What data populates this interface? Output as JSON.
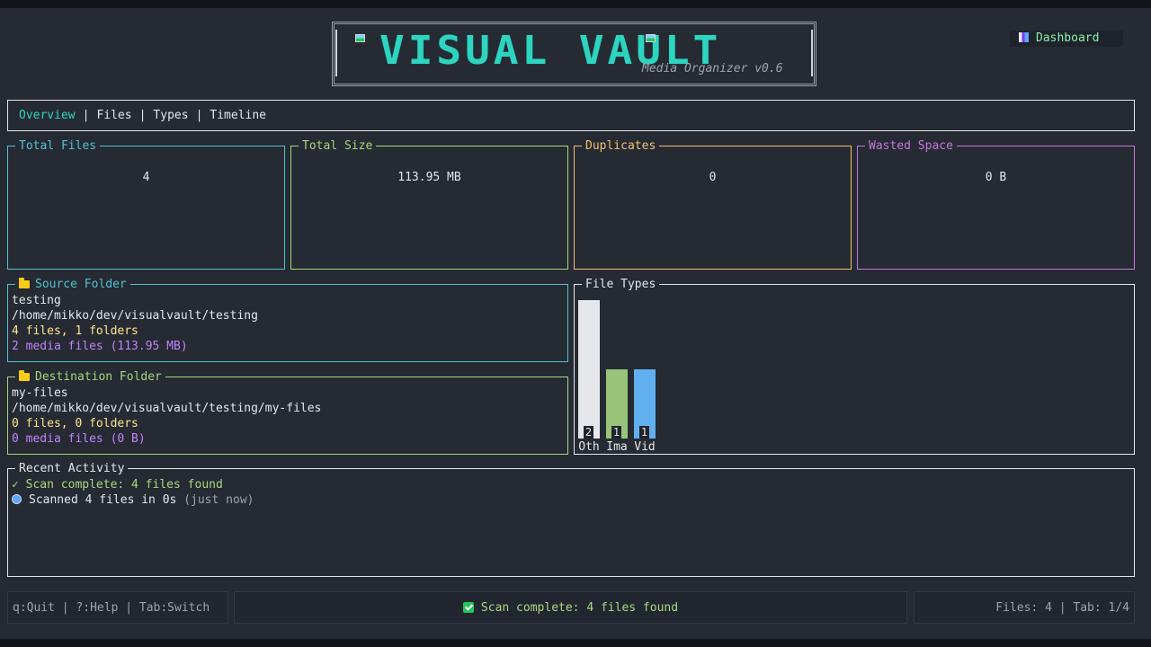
{
  "header": {
    "logo_text": "VISUAL VAULT",
    "subtitle": "Media Organizer v0.6",
    "dashboard_label": "Dashboard"
  },
  "tabs": [
    {
      "label": "Overview",
      "active": true
    },
    {
      "label": "Files"
    },
    {
      "label": "Types"
    },
    {
      "label": "Timeline"
    }
  ],
  "tab_separator": "|",
  "stats": {
    "total_files": {
      "label": "Total Files",
      "value": "4",
      "color": "#4fc3d6"
    },
    "total_size": {
      "label": "Total Size",
      "value": "113.95 MB",
      "color": "#a3d977"
    },
    "duplicates": {
      "label": "Duplicates",
      "value": "0",
      "color": "#f2c46d"
    },
    "wasted_space": {
      "label": "Wasted Space",
      "value": "0 B",
      "color": "#c678dd"
    }
  },
  "source_folder": {
    "title": "Source Folder",
    "name": "testing",
    "path": "/home/mikko/dev/visualvault/testing",
    "counts": "4 files, 1 folders",
    "media": "2 media files (113.95 MB)"
  },
  "destination_folder": {
    "title": "Destination Folder",
    "name": "my-files",
    "path": "/home/mikko/dev/visualvault/testing/my-files",
    "counts": "0 files, 0 folders",
    "media": "0 media files (0 B)"
  },
  "file_types_title": "File Types",
  "chart_data": {
    "type": "bar",
    "categories": [
      "Oth",
      "Ima",
      "Vid"
    ],
    "values": [
      2,
      1,
      1
    ],
    "colors": [
      "#e5e7eb",
      "#98c379",
      "#61afef"
    ],
    "title": "File Types",
    "ylim": [
      0,
      2
    ]
  },
  "recent_activity": {
    "title": "Recent Activity",
    "items": [
      {
        "text": "✓ Scan complete: 4 files found"
      },
      {
        "text": "Scanned 4 files in 0s",
        "suffix": "(just now)"
      }
    ]
  },
  "status_bar": {
    "keys": "q:Quit | ?:Help | Tab:Switch",
    "message": "Scan complete: 4 files found",
    "info": "Files: 4 | Tab: 1/4"
  }
}
